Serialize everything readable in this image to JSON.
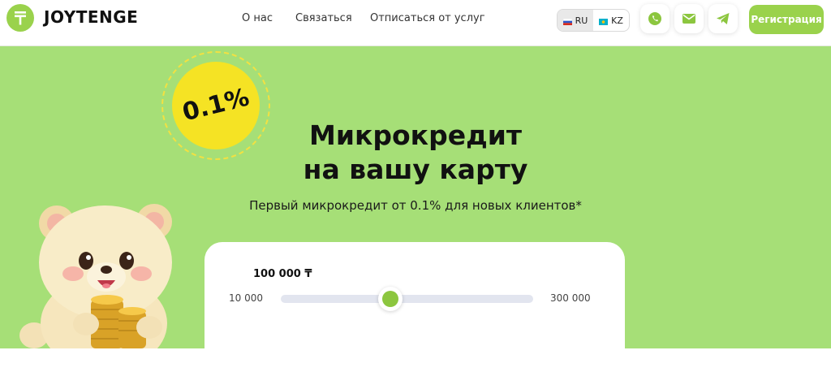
{
  "brand": {
    "name": "JOYTENGE",
    "logo_icon": "tenge-icon",
    "accent": "#9ad24c"
  },
  "nav": {
    "items": [
      {
        "label": "О нас"
      },
      {
        "label": "Связаться"
      },
      {
        "label": "Отписаться от услуг"
      }
    ]
  },
  "languages": {
    "options": [
      {
        "code": "RU",
        "flag": "russia-flag-icon",
        "active": true
      },
      {
        "code": "KZ",
        "flag": "kazakhstan-flag-icon",
        "active": false
      }
    ]
  },
  "contacts": {
    "icons": [
      "whatsapp-icon",
      "mail-icon",
      "telegram-icon"
    ]
  },
  "register_label": "Регистрация",
  "hero": {
    "badge": "0.1%",
    "title_line1": "Микрокредит",
    "title_line2": "на вашу карту",
    "subtitle": "Первый микрокредит от 0.1% для новых клиентов*",
    "background": "#a6df77",
    "badge_color": "#f5e324"
  },
  "calculator": {
    "amount": "100 000 ₸",
    "min_label": "10 000",
    "max_label": "300 000",
    "slider": {
      "min": 10000,
      "max": 300000,
      "value": 100000
    }
  }
}
